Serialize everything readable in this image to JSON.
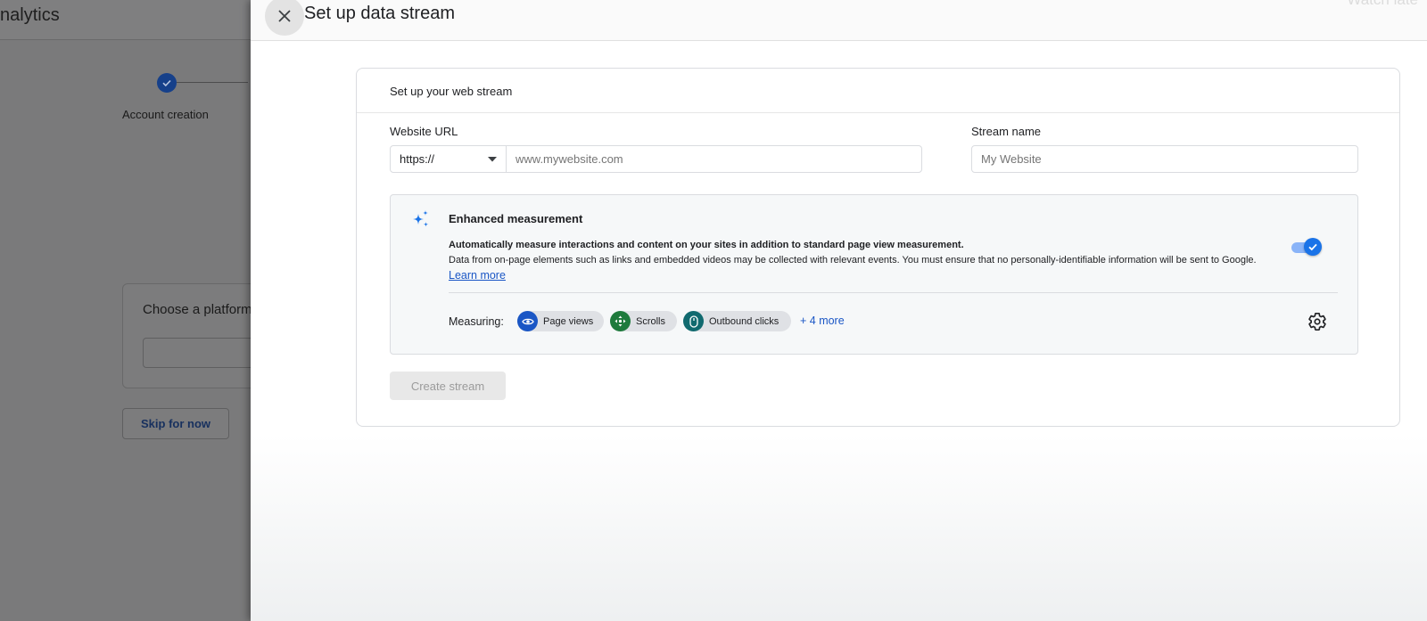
{
  "background": {
    "app_title": "nalytics",
    "step_label": "Account creation",
    "platform_card_title": "Choose a platform",
    "skip_button": "Skip for now"
  },
  "drawer": {
    "title": "Set up data stream",
    "overlay_text": "Watch late"
  },
  "card": {
    "header": "Set up your web stream",
    "website_url_label": "Website URL",
    "protocol_value": "https://",
    "url_placeholder": "www.mywebsite.com",
    "stream_name_label": "Stream name",
    "stream_name_placeholder": "My Website",
    "create_button": "Create stream"
  },
  "enhanced_measurement": {
    "title": "Enhanced measurement",
    "description_bold": "Automatically measure interactions and content on your sites in addition to standard page view measurement.",
    "description": "Data from on-page elements such as links and embedded videos may be collected with relevant events. You must ensure that no personally-identifiable information will be sent to Google.",
    "learn_more": "Learn more",
    "enabled": true,
    "measuring_label": "Measuring:",
    "chips": [
      {
        "label": "Page views",
        "icon": "eye-icon",
        "color": "#1a56c5"
      },
      {
        "label": "Scrolls",
        "icon": "scroll-arrows-icon",
        "color": "#1e7a3c"
      },
      {
        "label": "Outbound clicks",
        "icon": "mouse-icon",
        "color": "#116a6f"
      }
    ],
    "more_link": "+ 4 more"
  },
  "colors": {
    "accent": "#1a73e8",
    "link": "#1a56c5",
    "step_done": "#16408a"
  }
}
